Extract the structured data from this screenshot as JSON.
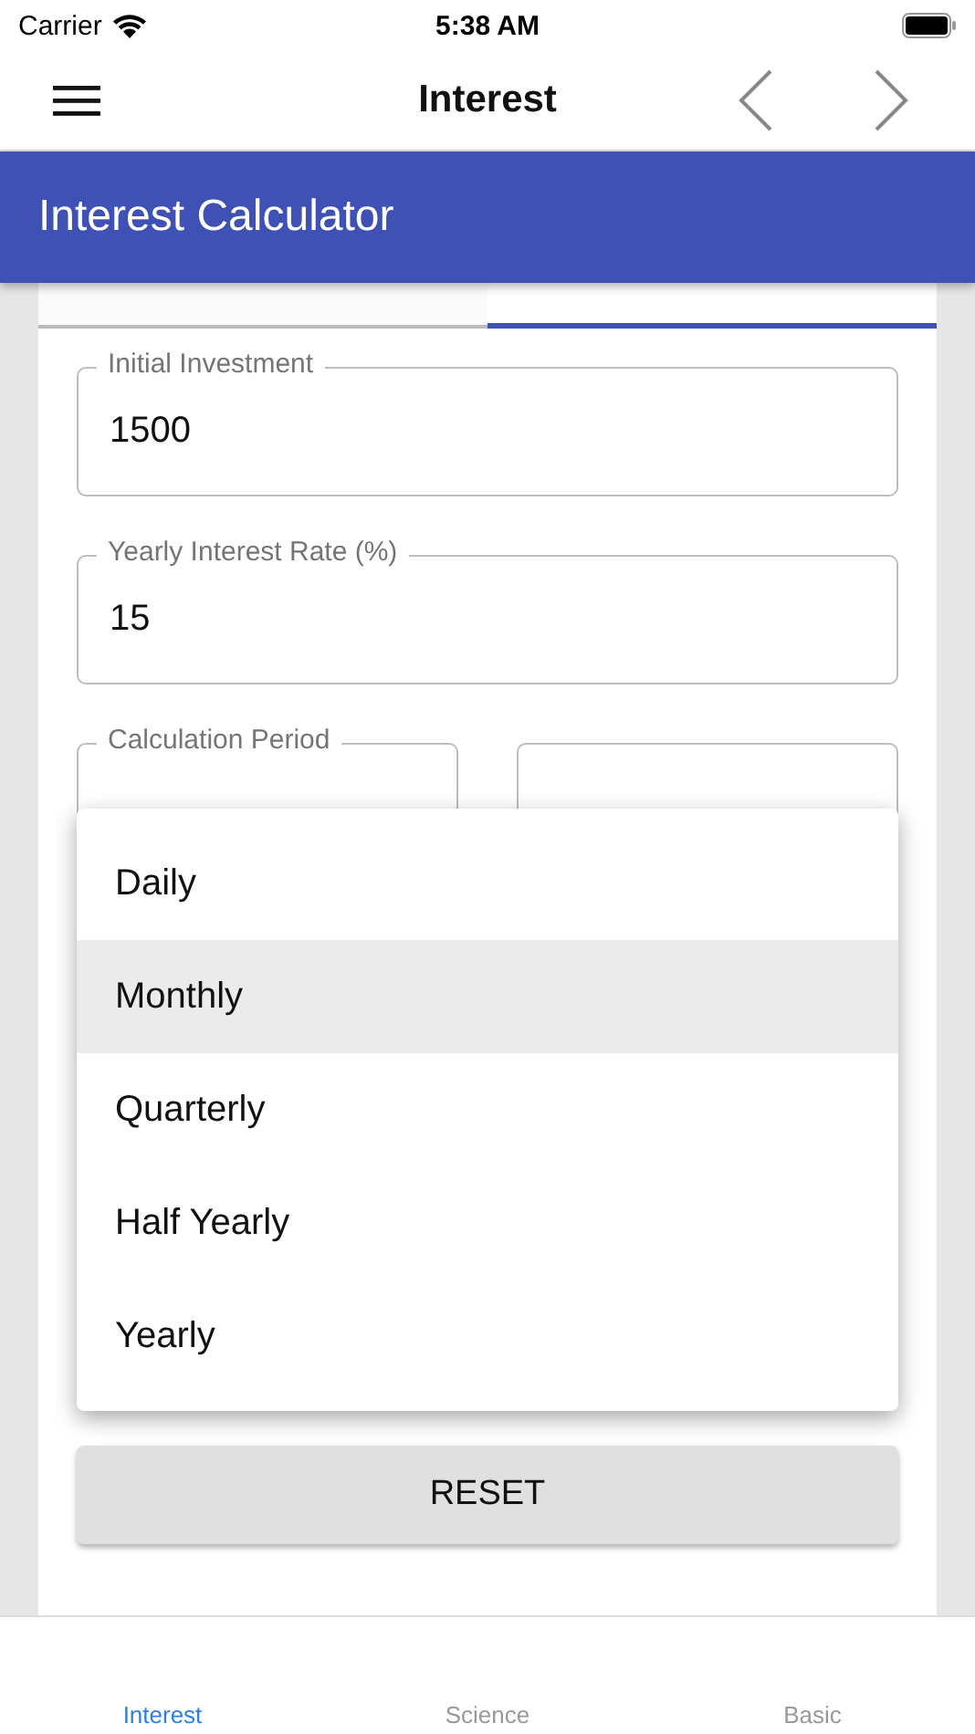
{
  "status_bar": {
    "carrier": "Carrier",
    "time": "5:38 AM"
  },
  "nav_bar": {
    "title": "Interest"
  },
  "app_bar": {
    "title": "Interest Calculator"
  },
  "tabs": [
    {
      "selected": false
    },
    {
      "selected": true
    }
  ],
  "fields": [
    {
      "label": "Initial Investment",
      "value": "1500"
    },
    {
      "label": "Yearly Interest Rate (%)",
      "value": "15"
    }
  ],
  "period": {
    "label": "Calculation Period"
  },
  "menu": [
    {
      "label": "Daily",
      "selected": false
    },
    {
      "label": "Monthly",
      "selected": true
    },
    {
      "label": "Quarterly",
      "selected": false
    },
    {
      "label": "Half Yearly",
      "selected": false
    },
    {
      "label": "Yearly",
      "selected": false
    }
  ],
  "reset_button": "RESET",
  "bottom_tabs": [
    {
      "label": "Interest",
      "selected": true
    },
    {
      "label": "Science",
      "selected": false
    },
    {
      "label": "Basic",
      "selected": false
    }
  ]
}
